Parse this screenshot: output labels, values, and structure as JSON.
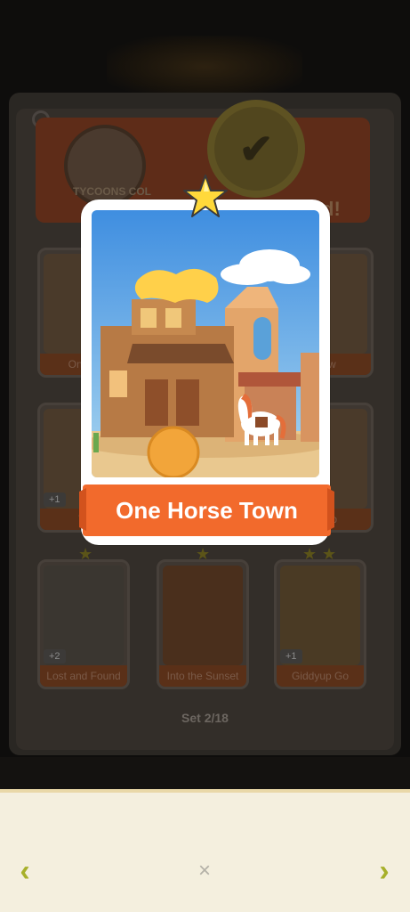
{
  "album": {
    "banner_text": "TYCOONS COL",
    "banner_suffix": "d!",
    "set_label": "Set 2/18"
  },
  "bg_cards": [
    {
      "label": "One H",
      "count": ""
    },
    {
      "label": "row",
      "count": ""
    },
    {
      "label": "W",
      "count": "+1"
    },
    {
      "label": "Nap",
      "count": ""
    },
    {
      "label": "Lost and Found",
      "count": "+2"
    },
    {
      "label": "Into the Sunset",
      "count": ""
    },
    {
      "label": "Giddyup Go",
      "count": "+1"
    }
  ],
  "featured_card": {
    "title": "One Horse Town",
    "stars": 1
  },
  "nav": {
    "prev_icon": "‹",
    "next_icon": "›",
    "close_icon": "×"
  },
  "colors": {
    "ribbon": "#f26a2c",
    "nav_arrow": "#a7b02a",
    "bottom_bg": "#f4efde"
  }
}
